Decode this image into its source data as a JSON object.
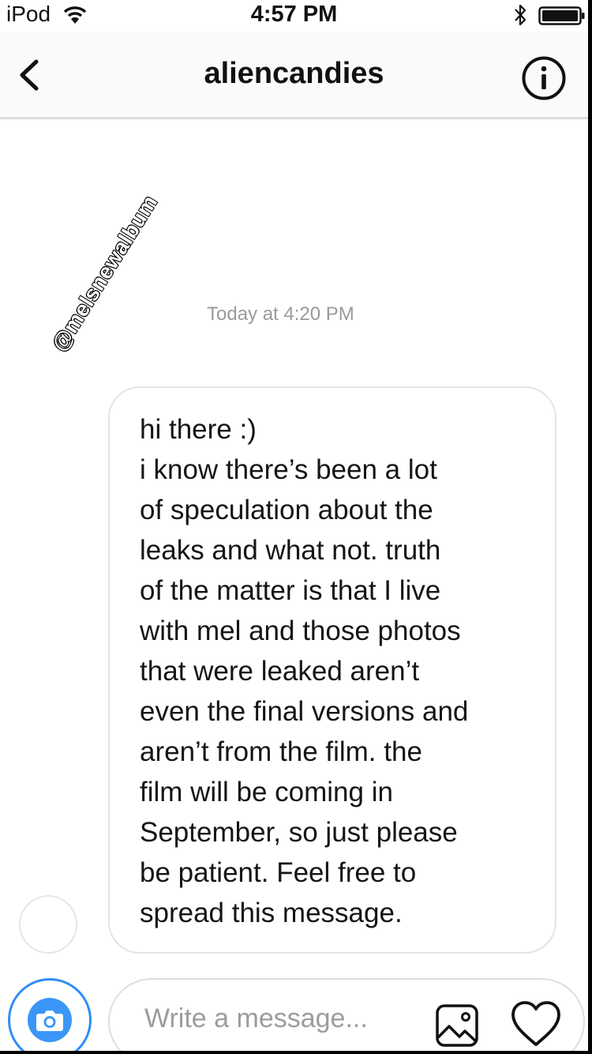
{
  "status_bar": {
    "carrier": "iPod",
    "time": "4:57 PM"
  },
  "header": {
    "title": "aliencandies"
  },
  "watermark": "@melsnewalbum",
  "conversation": {
    "timestamp": "Today at 4:20 PM",
    "message_lines": [
      "hi there :)",
      "i know there’s been a lot",
      "of speculation about the",
      "leaks and what not. truth",
      "of the matter is that I live",
      "with mel and those photos",
      "that were leaked aren’t",
      "even the final versions and",
      "aren’t from the film. the",
      "film will be coming in",
      "September, so just please",
      "be patient. Feel free to",
      "spread this message."
    ]
  },
  "composer": {
    "placeholder": "Write a message..."
  },
  "icons": {
    "wifi": "wifi-icon",
    "bluetooth": "bluetooth-icon",
    "battery": "battery-icon",
    "back": "chevron-left-icon",
    "info": "info-icon",
    "camera": "camera-icon",
    "gallery": "image-icon",
    "like": "heart-icon"
  },
  "colors": {
    "accent": "#3a96f7",
    "bubble_border": "#e3e3e3",
    "timestamp": "#9a9a9a"
  }
}
